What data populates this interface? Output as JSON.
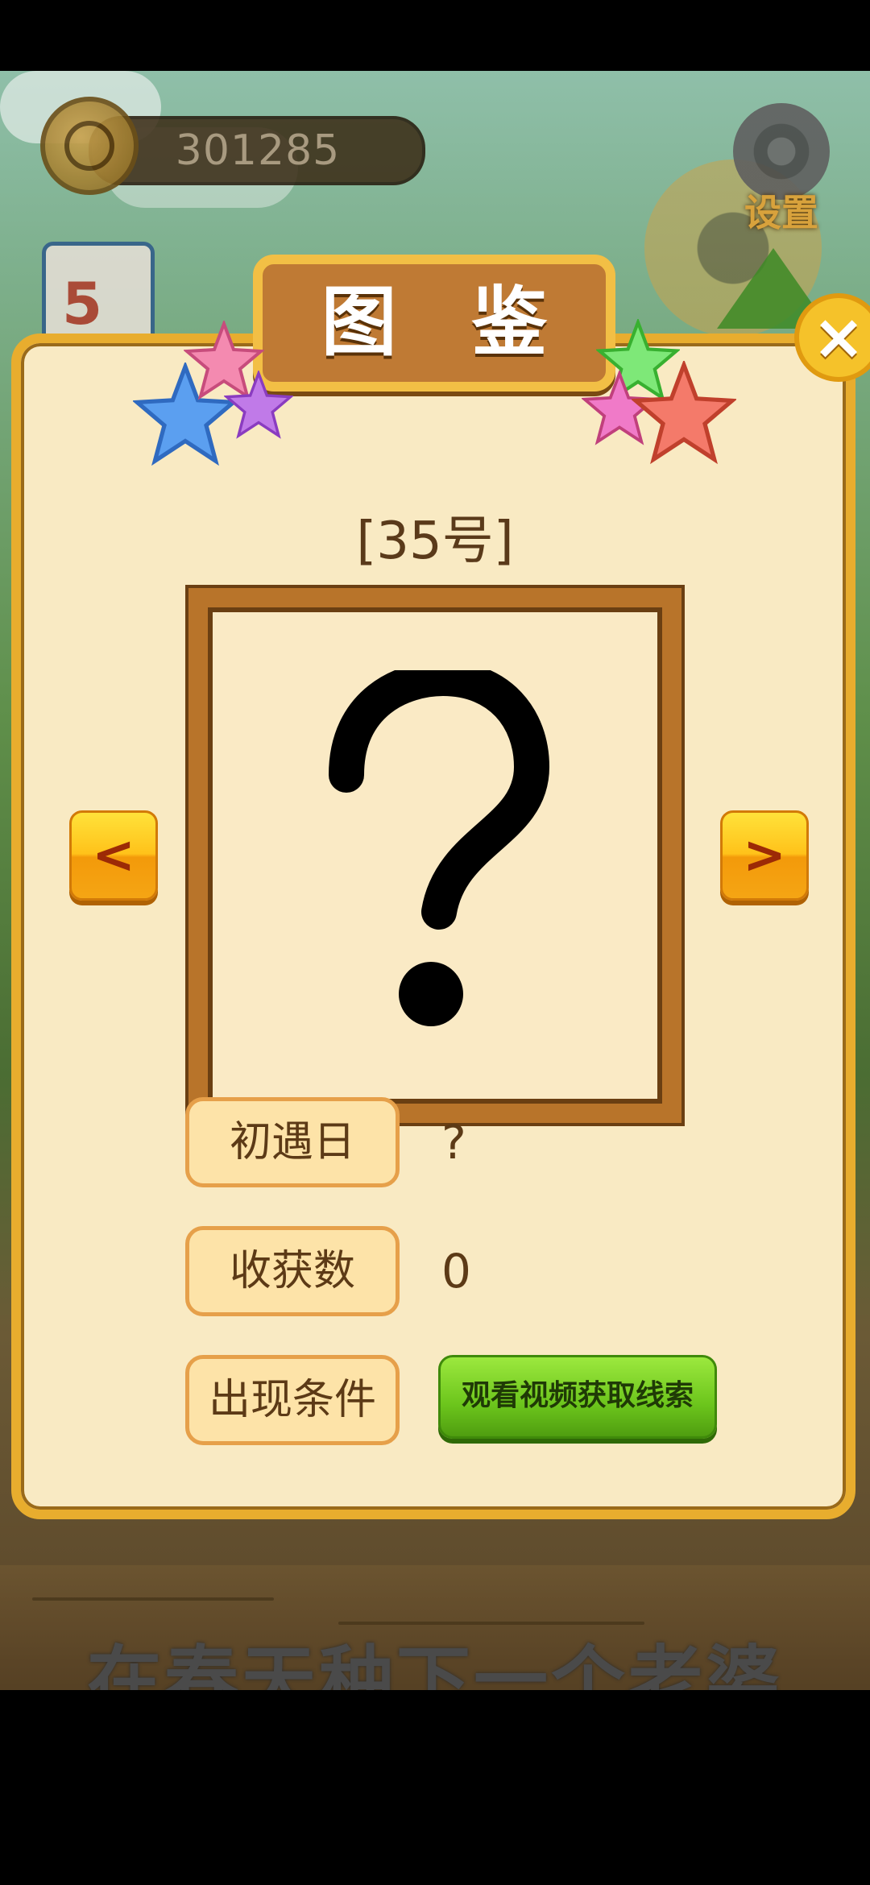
{
  "hud": {
    "coins": "301285",
    "settings_label": "设置",
    "calendar_day": "5"
  },
  "dialog": {
    "title": "图 鉴",
    "entry_number": "[35号]",
    "image_placeholder": "?",
    "prev_label": "<",
    "next_label": ">",
    "close_icon": "×",
    "fields": {
      "first_met_label": "初遇日",
      "first_met_value": "?",
      "harvest_label": "收获数",
      "harvest_value": "0",
      "condition_label": "出现条件",
      "condition_button": "观看视频获取线索"
    }
  },
  "banner": {
    "subtitle": "在春天种下一个老婆"
  },
  "colors": {
    "panel_bg": "#f9eac3",
    "panel_border": "#e8ad2e",
    "title_plate": "#bf7a34",
    "nav_button": "#ffc21a",
    "video_button": "#6cc51c"
  }
}
